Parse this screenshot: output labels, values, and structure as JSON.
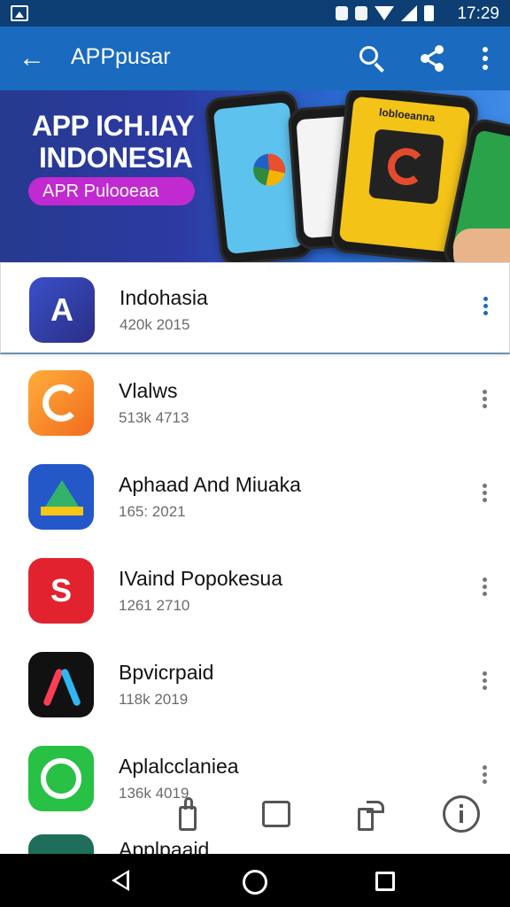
{
  "status_bar": {
    "time": "17:29",
    "icons": [
      "gallery-icon",
      "vibrate-icon",
      "sim-icon",
      "wifi-icon",
      "signal-icon",
      "battery-icon"
    ]
  },
  "app_bar": {
    "title": "APPpusar",
    "back_icon": "arrow-left-icon",
    "actions": [
      "search-icon",
      "share-icon",
      "more-vertical-icon"
    ]
  },
  "banner": {
    "line1": "APP ICH.IAY",
    "line2": "INDONESIA",
    "pill": "APR Pulooeaa",
    "phone_labels": [
      "lobloeanna"
    ]
  },
  "apps": [
    {
      "name": "Indohasia",
      "meta": "420k 2015",
      "icon": "blue-wing-icon",
      "letter": "A"
    },
    {
      "name": "Vlalws",
      "meta": "513k 4713",
      "icon": "orange-g-icon",
      "letter": ""
    },
    {
      "name": "Aphaad And Miuaka",
      "meta": "165: 2021",
      "icon": "drive-icon",
      "letter": ""
    },
    {
      "name": "IVaind Popokesua",
      "meta": "1261 2710",
      "icon": "red-s-icon",
      "letter": "S"
    },
    {
      "name": "Bpvicrpaid",
      "meta": "118k 2019",
      "icon": "a-logo-icon",
      "letter": ""
    },
    {
      "name": "Aplalcclaniea",
      "meta": "136k 4019",
      "icon": "green-chat-icon",
      "letter": ""
    },
    {
      "name": "Applpaaid",
      "meta": "",
      "icon": "teal-arrow-icon",
      "letter": ""
    }
  ],
  "bottom_actions": [
    "like-icon",
    "comment-icon",
    "share-out-icon",
    "info-icon"
  ],
  "nav": [
    "back-triangle-icon",
    "home-circle-icon",
    "recents-square-icon"
  ]
}
